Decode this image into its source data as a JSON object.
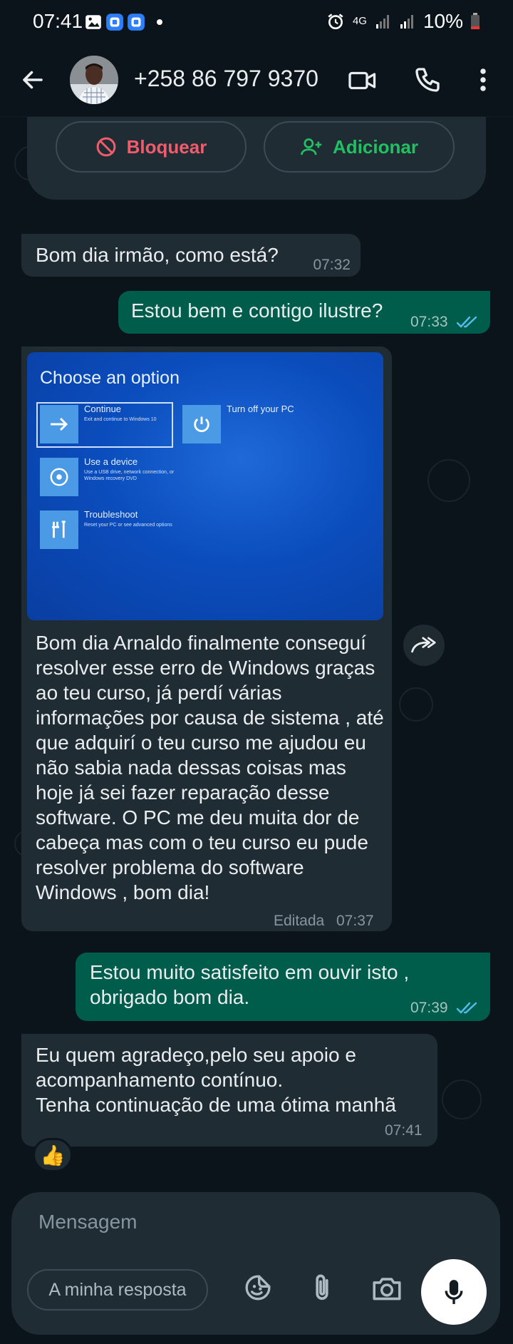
{
  "status_bar": {
    "time": "07:41",
    "network": "4G",
    "battery": "10%"
  },
  "header": {
    "contact": "+258 86 797 9370"
  },
  "blocked_actions": {
    "block_label": "Bloquear",
    "add_label": "Adicionar"
  },
  "messages": [
    {
      "dir": "in",
      "text": "Bom dia irmão, como está?",
      "time": "07:32"
    },
    {
      "dir": "out",
      "text": "Estou bem e contigo ilustre?",
      "time": "07:33"
    },
    {
      "dir": "in",
      "text": "Bom dia Arnaldo finalmente conseguí resolver esse erro de Windows graças ao teu curso, já perdí várias informações por causa de sistema , até que adquirí o teu curso me ajudou eu não sabia nada dessas coisas mas hoje já sei fazer reparação desse software. O PC me deu muita dor de cabeça mas com o teu curso eu pude resolver problema do software Windows , bom dia!",
      "edited_label": "Editada",
      "time": "07:37"
    },
    {
      "dir": "out",
      "text": "Estou muito satisfeito em ouvir isto , obrigado bom dia.",
      "time": "07:39"
    },
    {
      "dir": "in",
      "text": "Eu quem agradeço,pelo seu apoio e acompanhamento contínuo.\nTenha continuação de uma ótima manhã",
      "time": "07:41"
    }
  ],
  "windows_screen": {
    "title": "Choose an option",
    "continue_label": "Continue",
    "continue_sub": "Exit and continue to Windows 10",
    "turnoff_label": "Turn off your PC",
    "device_label": "Use a device",
    "device_sub": "Use a USB drive, network connection, or Windows recovery DVD",
    "troubleshoot_label": "Troubleshoot",
    "troubleshoot_sub": "Reset your PC or see advanced options"
  },
  "reaction": "👍",
  "composer": {
    "placeholder": "Mensagem",
    "quick_reply": "A minha resposta"
  },
  "colors": {
    "incoming_bubble": "#202c33",
    "outgoing_bubble": "#005c4b",
    "block_red": "#f15c6d",
    "add_green": "#21c063",
    "read_ticks": "#53bdeb"
  }
}
